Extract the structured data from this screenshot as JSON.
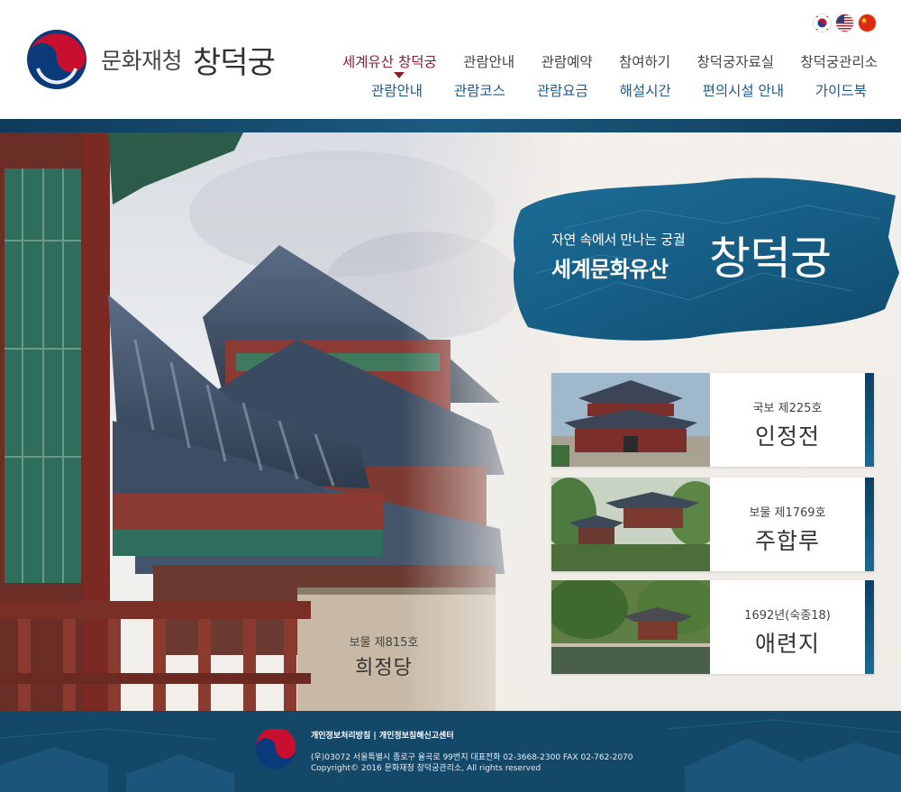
{
  "header": {
    "org_name": "문화재청",
    "site_name": "창덕궁",
    "languages": [
      "korean",
      "english",
      "chinese"
    ]
  },
  "gnb": {
    "main": [
      "세계유산 창덕궁",
      "관람안내",
      "관람예약",
      "참여하기",
      "창덕궁자료실",
      "창덕궁관리소"
    ],
    "active_index": 0,
    "sub": [
      "관람안내",
      "관람코스",
      "관람요금",
      "해설시간",
      "편의시설 안내",
      "가이드북"
    ]
  },
  "hero": {
    "subtitle": "자연 속에서 만나는 궁궐",
    "title": "세계문화유산",
    "big_title": "창덕궁"
  },
  "photo_caption": {
    "sub": "보물 제815호",
    "name": "희정당"
  },
  "cards": [
    {
      "sub": "국보 제225호",
      "name": "인정전"
    },
    {
      "sub": "보물 제1769호",
      "name": "주합루"
    },
    {
      "sub": "1692년(숙종18)",
      "name": "애련지"
    }
  ],
  "footer": {
    "link_privacy": "개인정보처리방침",
    "link_separator": " | ",
    "link_report": "개인정보침해신고센터",
    "address": "(우)03072 서울특별시 종로구 율곡로 99번지 대표전화 02-3668-2300 FAX 02-762-2070",
    "copyright": "Copyright© 2016 문화재청 창덕궁관리소, All rights reserved"
  },
  "colors": {
    "brand_red": "#8d1d2a",
    "brand_blue": "#1e5a86",
    "footer_bg": "#124467"
  }
}
